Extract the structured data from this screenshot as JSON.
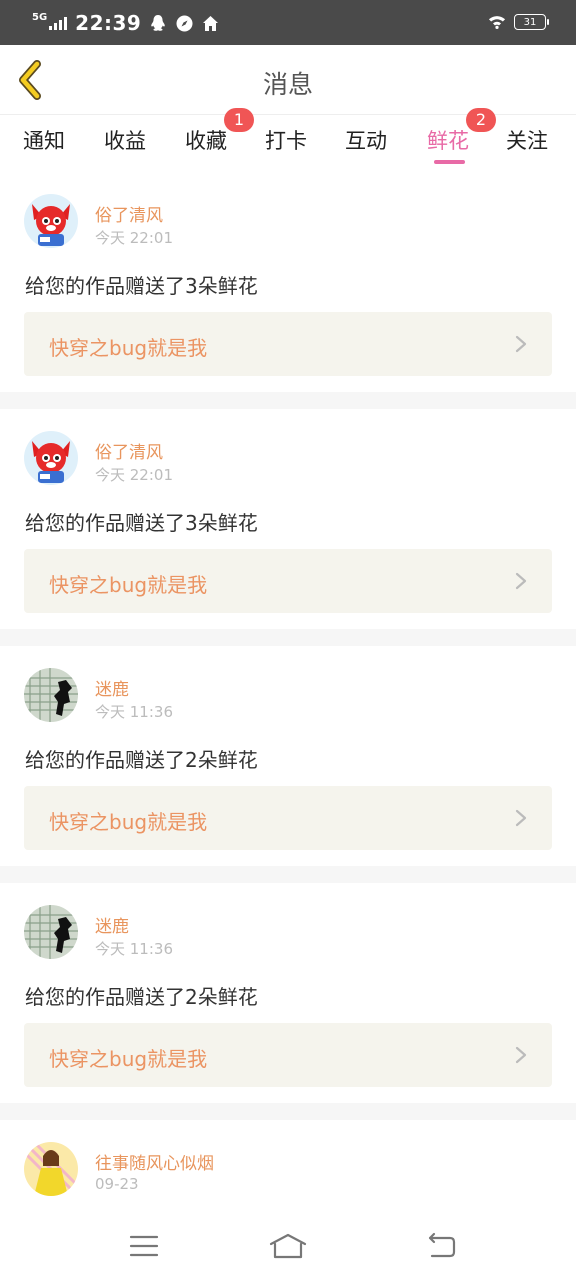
{
  "status_bar": {
    "network": "5G",
    "time": "22:39",
    "battery": "31",
    "icons": [
      "qq-icon",
      "compass-icon",
      "home-icon",
      "wifi-icon"
    ]
  },
  "header": {
    "title": "消息",
    "back_icon": "chevron-left-icon"
  },
  "tabs": [
    {
      "label": "通知"
    },
    {
      "label": "收益"
    },
    {
      "label": "收藏",
      "badge": "1"
    },
    {
      "label": "打卡"
    },
    {
      "label": "互动"
    },
    {
      "label": "鲜花",
      "badge": "2",
      "active": true
    },
    {
      "label": "关注"
    }
  ],
  "colors": {
    "accent": "#e86aa6",
    "username": "#e8955d",
    "badge": "#f05555",
    "work_bg": "#f5f4ed"
  },
  "messages": [
    {
      "user": "俗了清风",
      "time": "今天 22:01",
      "text": "给您的作品赠送了3朵鲜花",
      "work": "快穿之bug就是我",
      "avatar": "fox-avatar"
    },
    {
      "user": "俗了清风",
      "time": "今天 22:01",
      "text": "给您的作品赠送了3朵鲜花",
      "work": "快穿之bug就是我",
      "avatar": "fox-avatar"
    },
    {
      "user": "迷鹿",
      "time": "今天 11:36",
      "text": "给您的作品赠送了2朵鲜花",
      "work": "快穿之bug就是我",
      "avatar": "silhouette-avatar"
    },
    {
      "user": "迷鹿",
      "time": "今天 11:36",
      "text": "给您的作品赠送了2朵鲜花",
      "work": "快穿之bug就是我",
      "avatar": "silhouette-avatar"
    },
    {
      "user": "往事随风心似烟",
      "time": "09-23",
      "avatar": "girl-avatar"
    }
  ],
  "nav_bar": {
    "icons": [
      "menu-icon",
      "home-icon",
      "back-icon"
    ]
  }
}
